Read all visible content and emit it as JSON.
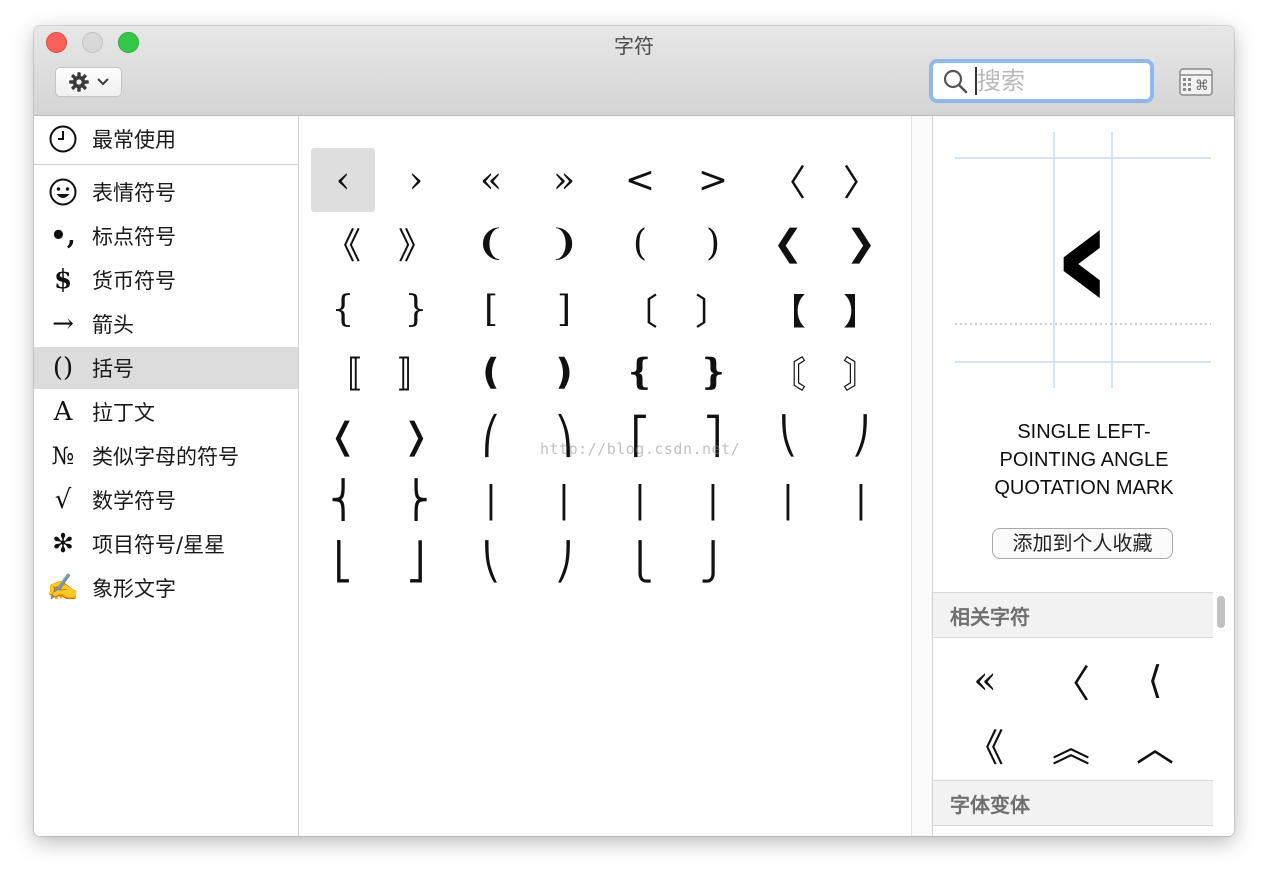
{
  "window": {
    "title": "字符"
  },
  "toolbar": {
    "search_placeholder": "搜索",
    "gear_icon": "gear-icon",
    "viewer_icon": "character-viewer-icon"
  },
  "sidebar": {
    "items": [
      {
        "icon": "clock-icon",
        "glyph": "",
        "label": "最常使用",
        "selected": false
      },
      {
        "icon": "smiley-icon",
        "glyph": "",
        "label": "表情符号",
        "selected": false
      },
      {
        "icon": "punctuation-icon",
        "glyph": "•,",
        "label": "标点符号",
        "selected": false
      },
      {
        "icon": "dollar-icon",
        "glyph": "$",
        "label": "货币符号",
        "selected": false
      },
      {
        "icon": "arrow-icon",
        "glyph": "→",
        "label": "箭头",
        "selected": false
      },
      {
        "icon": "parentheses-icon",
        "glyph": "()",
        "label": "括号",
        "selected": true
      },
      {
        "icon": "latin-a-icon",
        "glyph": "A",
        "label": "拉丁文",
        "selected": false
      },
      {
        "icon": "numero-icon",
        "glyph": "№",
        "label": "类似字母的符号",
        "selected": false
      },
      {
        "icon": "square-root-icon",
        "glyph": "√",
        "label": "数学符号",
        "selected": false
      },
      {
        "icon": "asterisk-icon",
        "glyph": "✻",
        "label": "项目符号/星星",
        "selected": false
      },
      {
        "icon": "pictograph-icon",
        "glyph": "✍",
        "label": "象形文字",
        "selected": false
      }
    ]
  },
  "grid": {
    "selected_index": 0,
    "rows": [
      [
        "‹",
        "›",
        "«",
        "»",
        "<",
        ">",
        "〈",
        "〉"
      ],
      [
        "《",
        "》",
        "❨",
        "❩",
        "(",
        ")",
        "❮",
        "❯"
      ],
      [
        "{",
        "}",
        "[",
        "]",
        "〔",
        "〕",
        "【",
        "】"
      ],
      [
        "〚",
        "〛",
        "❪",
        "❫",
        "❴",
        "❵",
        "〘",
        "〙"
      ],
      [
        "❬",
        "❭",
        "⎛",
        "⎞",
        "⎡",
        "⎤",
        "⎝",
        "⎠"
      ],
      [
        "⎨",
        "⎬",
        "|",
        "|",
        "|",
        "|",
        "|",
        "|"
      ],
      [
        "⎣",
        "⎦",
        "⎝",
        "⎠",
        "⎩",
        "⎭"
      ]
    ]
  },
  "inspector": {
    "preview_glyph": "‹",
    "character_name": [
      "SINGLE LEFT-",
      "POINTING ANGLE",
      "QUOTATION MARK"
    ],
    "add_favorite_label": "添加到个人收藏",
    "related_header": "相关字符",
    "related": [
      "«",
      "〈",
      "⟨",
      "《",
      "︽",
      "︿"
    ],
    "font_variants_header": "字体变体"
  },
  "watermark": "http://blog.csdn.net/"
}
